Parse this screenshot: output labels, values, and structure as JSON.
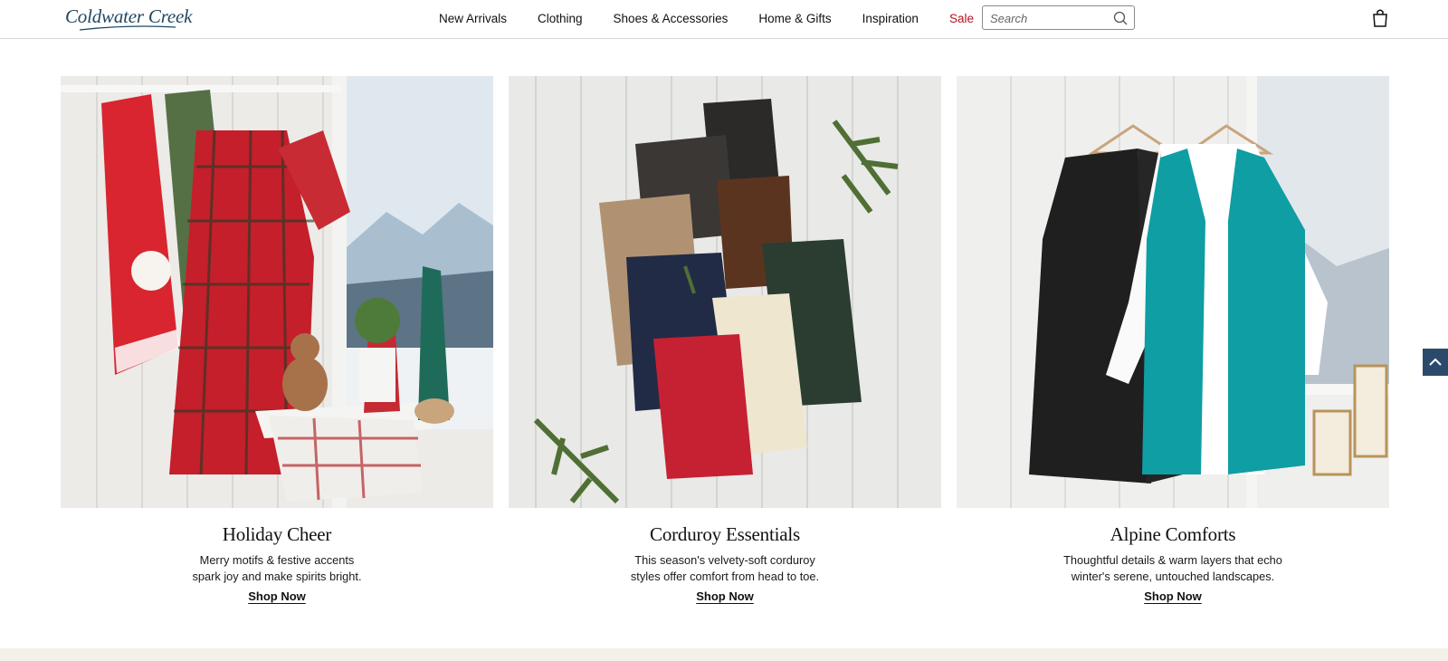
{
  "header": {
    "logo_text": "Coldwater Creek",
    "nav": [
      {
        "label": "New Arrivals"
      },
      {
        "label": "Clothing"
      },
      {
        "label": "Shoes & Accessories"
      },
      {
        "label": "Home & Gifts"
      },
      {
        "label": "Inspiration"
      },
      {
        "label": "Sale"
      }
    ],
    "search": {
      "placeholder": "Search",
      "value": ""
    },
    "icons": {
      "search": "search-icon",
      "bag": "shopping-bag-icon"
    }
  },
  "cards": [
    {
      "title": "Holiday Cheer",
      "desc_line1": "Merry motifs & festive accents",
      "desc_line2": "spark joy and make spirits bright.",
      "cta": "Shop Now"
    },
    {
      "title": "Corduroy Essentials",
      "desc_line1": "This season's velvety-soft corduroy",
      "desc_line2": "styles offer comfort from head to toe.",
      "cta": "Shop Now"
    },
    {
      "title": "Alpine Comforts",
      "desc_line1": "Thoughtful details & warm layers that echo",
      "desc_line2": "winter's serene, untouched landscapes.",
      "cta": "Shop Now"
    }
  ],
  "colors": {
    "brand": "#1f4763",
    "sale": "#b3121f",
    "scroll_button": "#2b4a6b",
    "footer_band": "#f4f1e8"
  },
  "scroll_top_icon": "chevron-up-icon"
}
